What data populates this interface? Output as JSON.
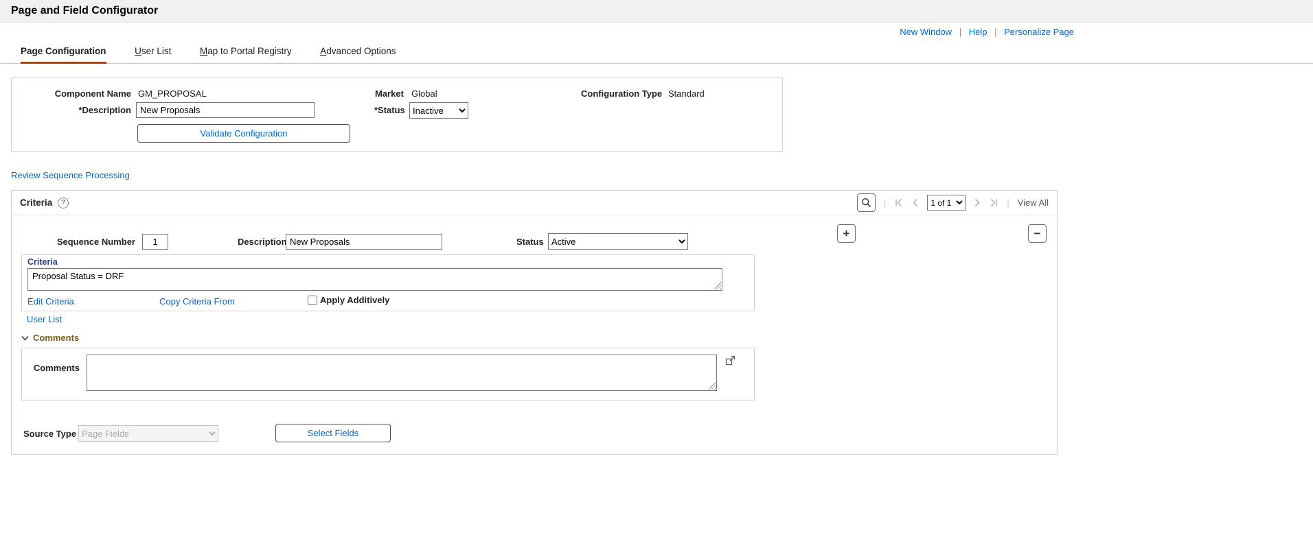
{
  "colors": {
    "accent": "#9a4a21",
    "link": "#0066cc",
    "criteria_label": "#26418f",
    "comments_label": "#7a5c16"
  },
  "title_bar": {
    "title": "Page and Field Configurator"
  },
  "util_links": {
    "new_window": "New Window",
    "help": "Help",
    "personalize": "Personalize Page",
    "sep": "|"
  },
  "tabs": {
    "page_configuration": "Page Configuration",
    "user_list": "User List",
    "map_to_portal_registry": "Map to Portal Registry",
    "advanced_options": "Advanced Options"
  },
  "component": {
    "component_name_label": "Component Name",
    "component_name_value": "GM_PROPOSAL",
    "market_label": "Market",
    "market_value": "Global",
    "configuration_type_label": "Configuration Type",
    "configuration_type_value": "Standard",
    "description_label": "*Description",
    "description_value": "New Proposals",
    "status_label": "*Status",
    "status_value": "Inactive",
    "validate_button": "Validate Configuration"
  },
  "review_sequence_link": "Review Sequence Processing",
  "criteria": {
    "title": "Criteria",
    "paging": {
      "record_range": "1 of 1",
      "view_all": "View All",
      "sep": "|"
    },
    "fields": {
      "sequence_label": "Sequence Number",
      "sequence_value": "1",
      "description_label": "Description",
      "description_value": "New Proposals",
      "status_label": "Status",
      "status_value": "Active"
    },
    "criteria_box": {
      "title": "Criteria",
      "value": "Proposal Status = DRF",
      "edit_link": "Edit Criteria",
      "copy_link": "Copy Criteria From",
      "apply_additively": "Apply Additively"
    },
    "user_list_link": "User List",
    "comments": {
      "section_title": "Comments",
      "label": "Comments",
      "value": ""
    },
    "source": {
      "label": "Source Type",
      "value": "Page Fields",
      "button": "Select Fields"
    }
  },
  "icons": {
    "plus": "+",
    "minus": "−",
    "help": "?"
  }
}
